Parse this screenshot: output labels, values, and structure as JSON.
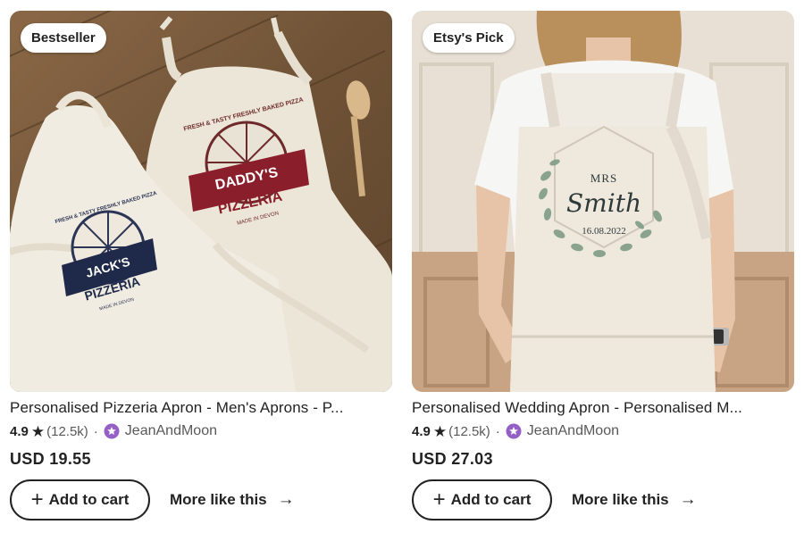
{
  "products": [
    {
      "badge": "Bestseller",
      "image_alt": "Pizzeria aprons",
      "title": "Personalised Pizzeria Apron - Men's Aprons - P...",
      "rating": "4.9",
      "review_count": "(12.5k)",
      "shop": "JeanAndMoon",
      "price": "USD 19.55",
      "add_to_cart_label": "Add to cart",
      "more_like_this_label": "More like this",
      "apron_text": {
        "daddy_line1": "DADDY'S",
        "daddy_line2": "PIZZERIA",
        "daddy_arc": "FRESH & TASTY FRESHLY BAKED PIZZA",
        "daddy_sub": "MADE IN DEVON",
        "jack_line1": "JACK'S",
        "jack_line2": "PIZZERIA",
        "jack_arc": "FRESH & TASTY FRESHLY BAKED PIZZA",
        "jack_sub": "MADE IN DEVON"
      }
    },
    {
      "badge": "Etsy's Pick",
      "image_alt": "Wedding apron",
      "title": "Personalised Wedding Apron - Personalised M...",
      "rating": "4.9",
      "review_count": "(12.5k)",
      "shop": "JeanAndMoon",
      "price": "USD 27.03",
      "add_to_cart_label": "Add to cart",
      "more_like_this_label": "More like this",
      "apron_text": {
        "mrs": "MRS",
        "name": "Smith",
        "date": "16.08.2022"
      }
    }
  ],
  "icons": {
    "star": "star-icon",
    "star_seller": "star-seller-icon",
    "plus": "plus-icon",
    "arrow": "arrow-right-icon"
  },
  "colors": {
    "text": "#222222",
    "muted": "#595959",
    "star_seller": "#9560c6",
    "daddy_banner": "#8b1e2b",
    "jack_banner": "#1f2a4a"
  }
}
